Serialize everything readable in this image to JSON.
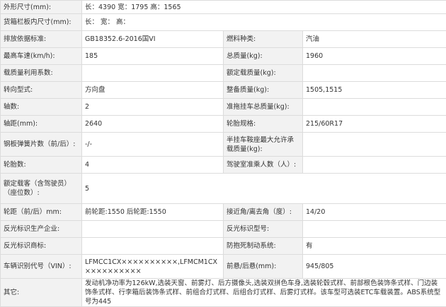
{
  "spec_rows": [
    {
      "label": "外形尺寸(mm):",
      "value": "长：4390 宽：1795 高：1565"
    },
    {
      "label": "货箱栏板内尺寸(mm):",
      "value": "长： 宽： 高："
    },
    {
      "label": "排放依据标准:",
      "value": "GB18352.6-2016国VI",
      "label2": "燃料种类:",
      "value2": "汽油"
    },
    {
      "label": "最高车速(km/h):",
      "value": "185",
      "label2": "总质量(kg):",
      "value2": "1960"
    },
    {
      "label": "载质量利用系数:",
      "value": "",
      "label2": "额定载质量(kg):",
      "value2": ""
    },
    {
      "label": "转向型式:",
      "value": "方向盘",
      "label2": "整备质量(kg):",
      "value2": "1505,1515"
    },
    {
      "label": "轴数:",
      "value": "2",
      "label2": "准拖挂车总质量(kg):",
      "value2": ""
    },
    {
      "label": "轴距(mm):",
      "value": "2640",
      "label2": "轮胎规格:",
      "value2": "215/60R17"
    },
    {
      "label": "钢板弹簧片数（前/后）:",
      "value": "-/-",
      "label2": "半挂车鞍座最大允许承载质量(kg):",
      "value2": ""
    },
    {
      "label": "轮胎数:",
      "value": "4",
      "label2": "驾驶室准乘人数（人）:",
      "value2": ""
    },
    {
      "label": "额定载客（含驾驶员）（座位数）:",
      "value": "5"
    },
    {
      "label": "轮距（前/后）mm:",
      "value": "前轮距:1550 后轮距:1550",
      "label2": "接近角/离去角（度）:",
      "value2": "14/20"
    },
    {
      "label": "反光标识生产企业:",
      "value": "",
      "label2": "反光标识型号:",
      "value2": ""
    },
    {
      "label": "反光标识商标:",
      "value": "",
      "label2": "防抱死制动系统:",
      "value2": "有"
    },
    {
      "label": "车辆识别代号（VIN）:",
      "value": "LFMCC1CX××××××××××,LFMCM1CX××××××××××",
      "label2": "前悬/后悬(mm):",
      "value2": "945/805"
    },
    {
      "label": "其它:",
      "value": "发动机净功率为126kW,选装天窗、前雾灯、后方摄像头,选装双拼色车身,选装轮毂式样、前部根色装饰条式样、门边装饰条式样、行李箱后装饰条式样、前组合灯式样、后组合灯式样、后雾灯式样。该车型可选装ETC车载装置。ABS系统型号为445"
    }
  ]
}
